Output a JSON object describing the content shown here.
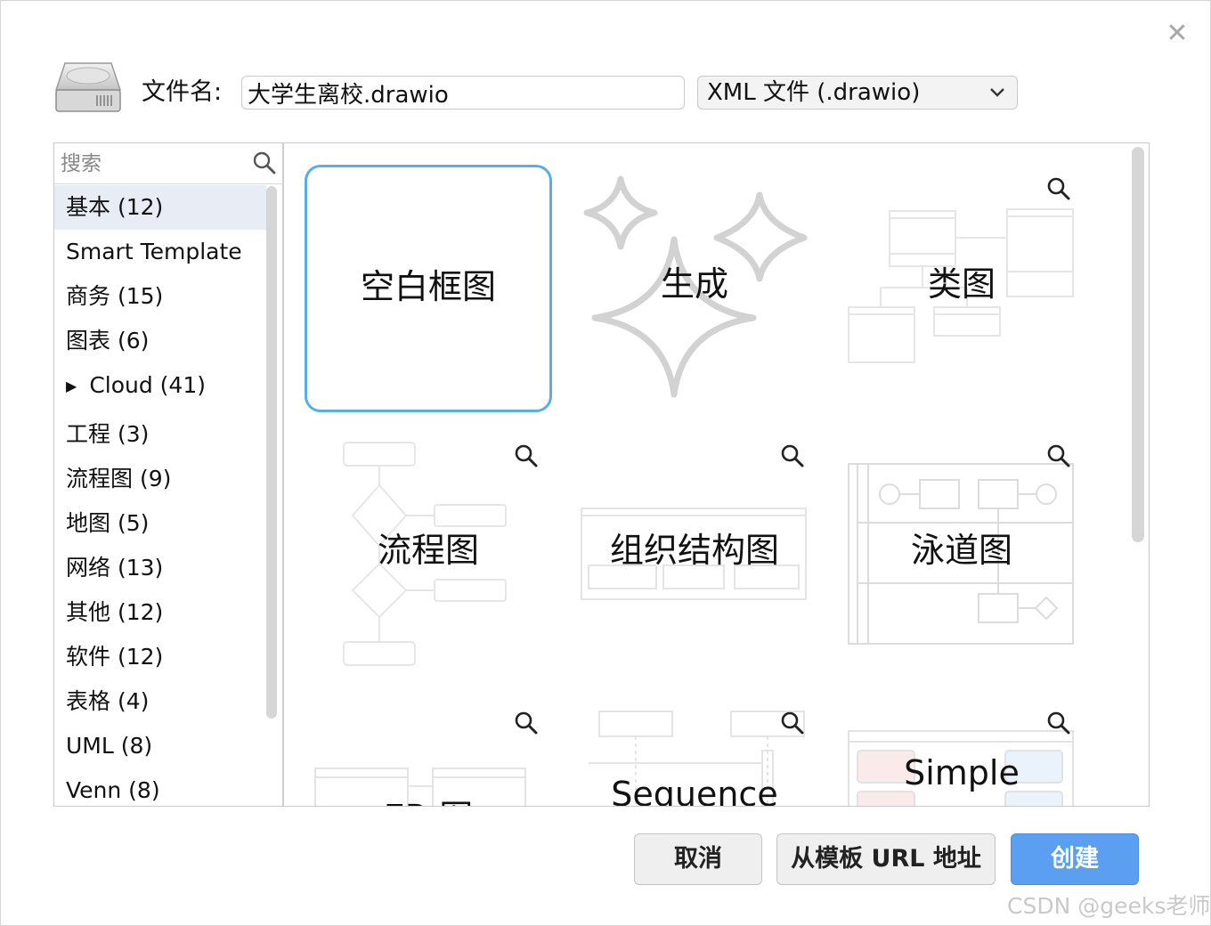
{
  "header": {
    "filename_label": "文件名:",
    "filename_value": "大学生离校.drawio",
    "filetype_selected": "XML 文件 (.drawio)"
  },
  "sidebar": {
    "search_placeholder": "搜索",
    "categories": [
      {
        "label": "基本 (12)"
      },
      {
        "label": "Smart Template"
      },
      {
        "label": "商务 (15)"
      },
      {
        "label": "图表 (6)"
      },
      {
        "label": "Cloud (41)",
        "expander": "▶"
      },
      {
        "label": "工程 (3)"
      },
      {
        "label": "流程图 (9)"
      },
      {
        "label": "地图 (5)"
      },
      {
        "label": "网络 (13)"
      },
      {
        "label": "其他 (12)"
      },
      {
        "label": "软件 (12)"
      },
      {
        "label": "表格 (4)"
      },
      {
        "label": "UML (8)"
      },
      {
        "label": "Venn (8)"
      }
    ]
  },
  "templates": [
    {
      "label": "空白框图",
      "selected": true
    },
    {
      "label": "生成"
    },
    {
      "label": "类图"
    },
    {
      "label": "流程图"
    },
    {
      "label": "组织结构图"
    },
    {
      "label": "泳道图"
    },
    {
      "label": "ER 图"
    },
    {
      "label": "Sequence"
    },
    {
      "label": "Simple"
    }
  ],
  "buttons": {
    "cancel": "取消",
    "from_url": "从模板 URL 地址",
    "create": "创建"
  },
  "watermark": "CSDN @geeks老师",
  "colors": {
    "selection_border": "#5aaee6",
    "primary_button": "#5b9ff0",
    "selected_category_bg": "#e8edf5"
  },
  "icons": {
    "close": "close-icon",
    "drive": "hard-drive-icon",
    "search": "search-icon",
    "zoom": "magnifier-icon",
    "dropdown": "chevron-down-icon"
  }
}
